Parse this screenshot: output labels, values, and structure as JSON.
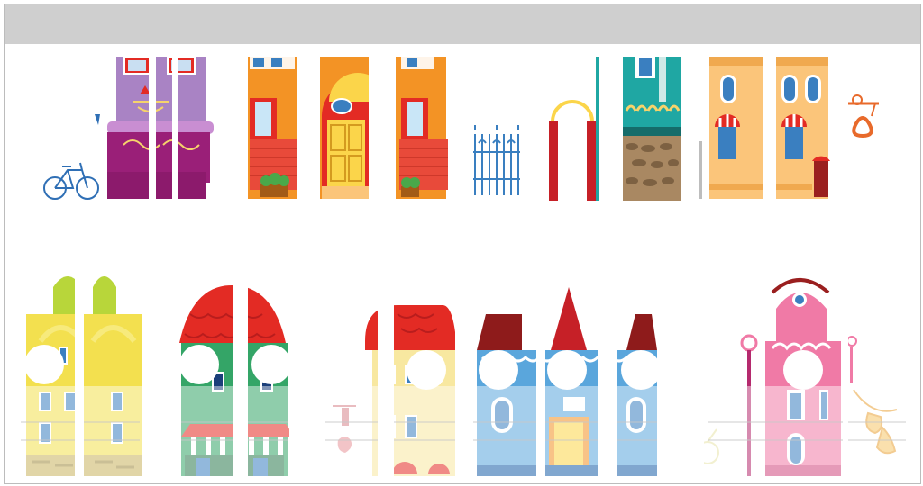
{
  "window": {
    "title": ""
  },
  "illustration": {
    "subject": "",
    "palette": {
      "purple": "#a983c4",
      "magenta": "#9a1f78",
      "orange": "#f39325",
      "red": "#e32b24",
      "teal": "#1fa7a3",
      "peach": "#fbc57a",
      "yellow": "#f3e04f",
      "green": "#34a567",
      "blue": "#5aa6dc",
      "darkred": "#8e1b1b",
      "pink": "#f07aa6",
      "brick": "#e84a3a",
      "stone": "#a98862",
      "gate": "#3a7fc0"
    }
  }
}
